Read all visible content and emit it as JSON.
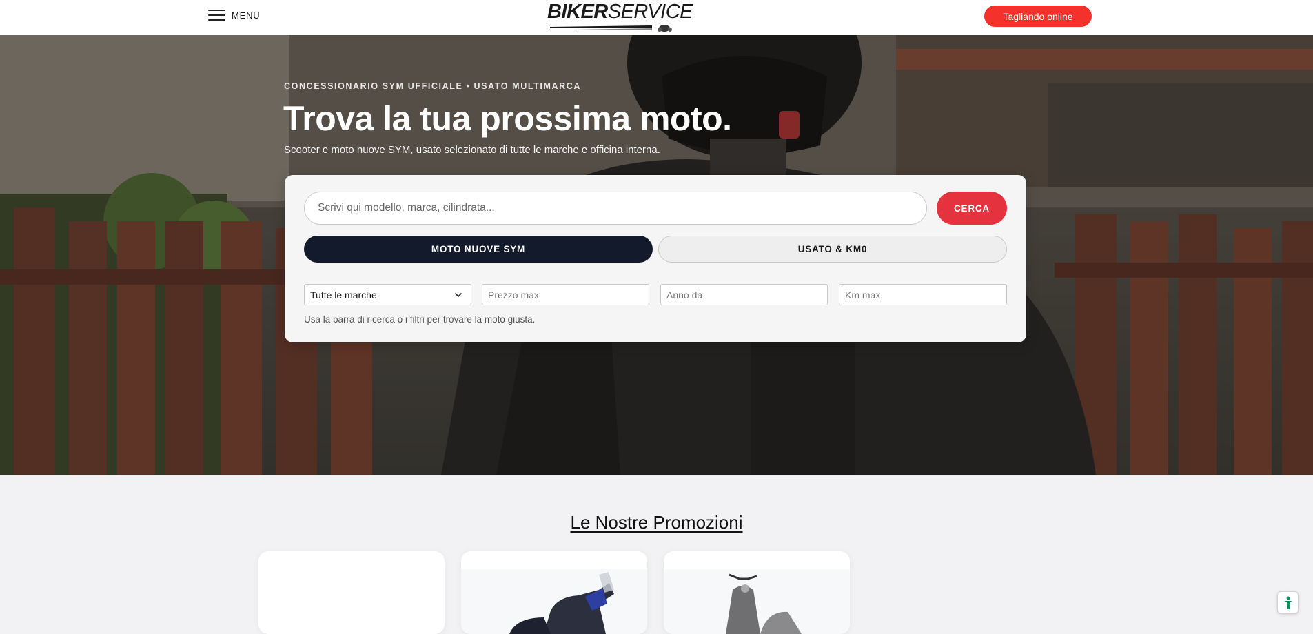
{
  "header": {
    "menu_label": "MENU",
    "logo_bold": "BIKER",
    "logo_light": "SERVICE",
    "cta_label": "Tagliando online"
  },
  "hero": {
    "kicker": "CONCESSIONARIO SYM UFFICIALE • USATO MULTIMARCA",
    "title": "Trova la tua prossima moto.",
    "subtitle": "Scooter e moto nuove SYM, usato selezionato di tutte le marche e officina interna."
  },
  "search": {
    "placeholder": "Scrivi qui modello, marca, cilindrata...",
    "button_label": "CERCA",
    "tabs": [
      {
        "label": "MOTO NUOVE SYM",
        "active": true
      },
      {
        "label": "USATO & KM0",
        "active": false
      }
    ],
    "filters": {
      "brand_selected": "Tutte le marche",
      "price_placeholder": "Prezzo max",
      "year_placeholder": "Anno da",
      "km_placeholder": "Km max"
    },
    "hint": "Usa la barra di ricerca o i filtri per trovare la moto giusta."
  },
  "promotions": {
    "title": "Le Nostre Promozioni"
  },
  "colors": {
    "brand_red": "#f5312b",
    "search_red": "#e5323f",
    "dark_navy": "#131a2b"
  },
  "icons": [
    "hamburger-icon",
    "chevron-down-icon",
    "accessibility-icon"
  ]
}
